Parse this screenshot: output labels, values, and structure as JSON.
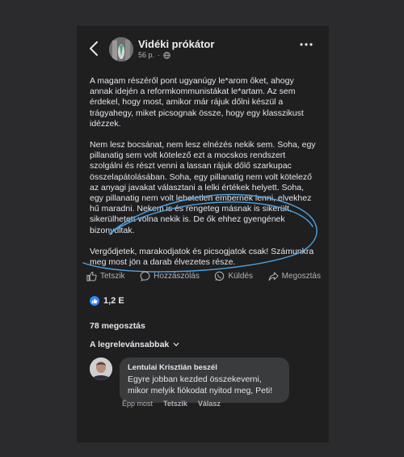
{
  "post": {
    "page_name": "Vidéki prókátor",
    "time": "56 p.",
    "paragraphs": [
      "A magam részéről pont ugyanúgy le*arom őket, ahogy annak idején a reformkommunistákat le*artam. Az sem érdekel, hogy most, amikor már rájuk dőlni készül a trágyahegy, miket picsognak össze, hogy egy klasszikust idézzek.",
      "Nem lesz bocsánat, nem lesz elnézés nekik sem. Soha, egy pillanatig sem volt kötelező ezt a mocskos rendszert szolgálni és részt venni a lassan rájuk dőlő szarkupac összelapátolásában. Soha, egy pillanatig nem volt kötelező az anyagi javakat választani a lelki értékek helyett. Soha, egy pillanatig nem volt lehetetlen embernek lenni, elvekhez hű maradni. Nekem is és rengeteg másnak is sikerült, sikerülhetett volna nekik is. De ők ehhez gyengének bizonyultak.",
      "Vergődjetek, marakodjatok és picsogjatok csak! Számunkra meg most jön a darab élvezetes része."
    ],
    "actions": {
      "like": "Tetszik",
      "comment": "Hozzászólás",
      "send": "Küldés",
      "share": "Megosztás"
    },
    "reactions_count": "1,2 E",
    "shares_count": "78 megosztás",
    "sort_label": "A legrelevánsabbak"
  },
  "comment": {
    "author": "Lentulai Krisztián beszél",
    "text": "Egyre jobban kezded összekeverni, mikor melyik fiókodat nyitod meg, Peti!",
    "time": "Épp most",
    "like": "Tetszik",
    "reply": "Válasz"
  },
  "colors": {
    "background": "#1f1f20",
    "accent": "#2d88ff",
    "annotation": "#4fa3e0"
  }
}
